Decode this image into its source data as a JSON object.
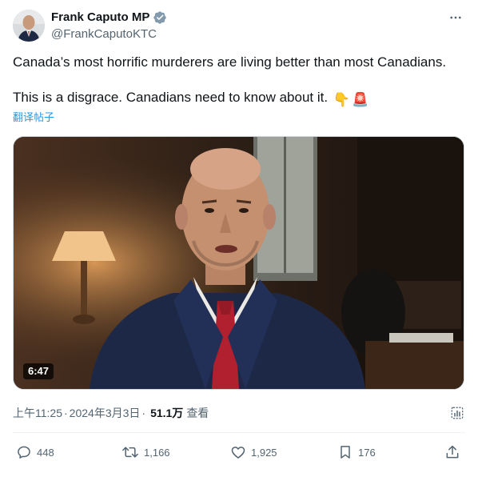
{
  "author": {
    "display_name": "Frank Caputo MP",
    "handle": "@FrankCaputoKTC",
    "verified_icon": "verified-badge-icon",
    "avatar_icon": "avatar"
  },
  "tweet": {
    "line1": "Canada’s most horrific murderers are living better than most Canadians.",
    "line2": "This is a disgrace. Canadians need to know about it.",
    "emoji1": "👇",
    "emoji2": "🚨",
    "translate_label": "翻译帖子"
  },
  "media": {
    "duration": "6:47"
  },
  "meta": {
    "time": "上午11:25",
    "separator": "·",
    "date": "2024年3月3日",
    "views_count": "51.1万",
    "views_label": "查看"
  },
  "actions": {
    "replies": "448",
    "reposts": "1,166",
    "likes": "1,925",
    "bookmarks": "176"
  },
  "colors": {
    "text_primary": "#0f1419",
    "text_secondary": "#536471",
    "link": "#1d9bf0",
    "verified_badge": "#829aab"
  }
}
